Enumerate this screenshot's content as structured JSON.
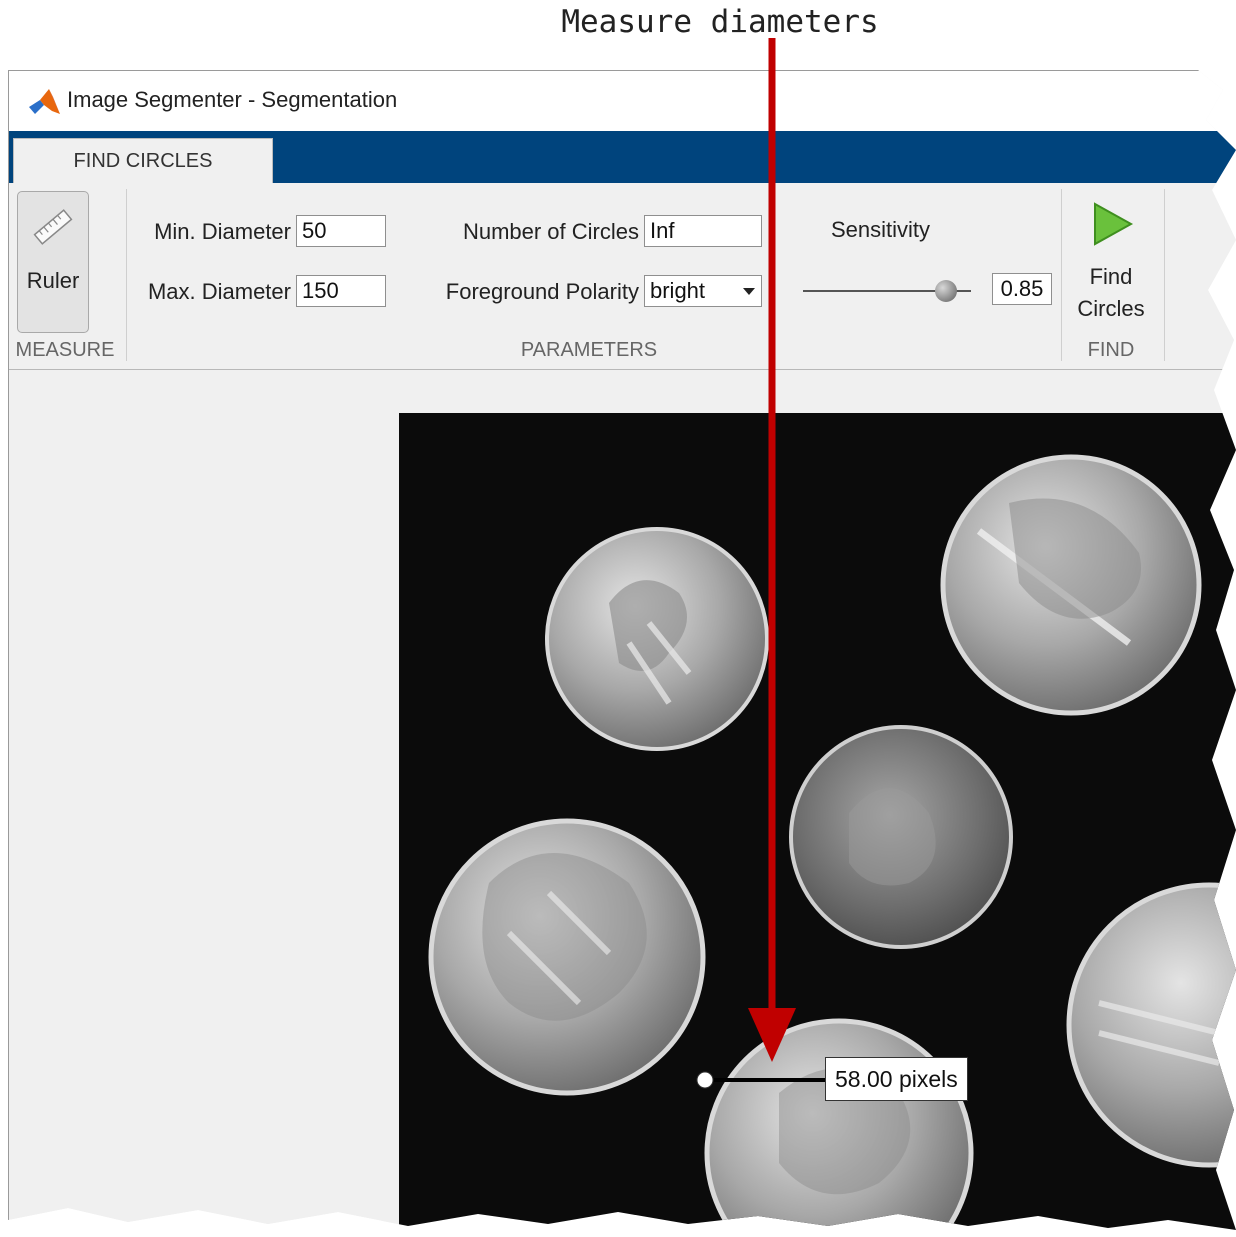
{
  "annotation": {
    "caption": "Measure diameters"
  },
  "window": {
    "title": "Image Segmenter - Segmentation",
    "app_icon": "matlab-logo-icon"
  },
  "tabs": [
    {
      "label": "FIND CIRCLES",
      "selected": true
    }
  ],
  "toolstrip": {
    "measure": {
      "section_label": "MEASURE",
      "ruler_label": "Ruler",
      "icon": "ruler-icon"
    },
    "parameters": {
      "section_label": "PARAMETERS",
      "min_diameter_label": "Min. Diameter",
      "min_diameter_value": "50",
      "max_diameter_label": "Max. Diameter",
      "max_diameter_value": "150",
      "num_circles_label": "Number of Circles",
      "num_circles_value": "Inf",
      "polarity_label": "Foreground Polarity",
      "polarity_value": "bright",
      "sensitivity_label": "Sensitivity",
      "sensitivity_value": "0.85",
      "sensitivity_fraction": 0.85
    },
    "find": {
      "section_label": "FIND",
      "button_line1": "Find",
      "button_line2": "Circles",
      "icon": "play-icon"
    }
  },
  "image": {
    "measurement_label": "58.00 pixels"
  },
  "colors": {
    "tab_strip": "#00447d",
    "accent_arrow": "#c00000",
    "play_icon": "#6ac13c"
  }
}
